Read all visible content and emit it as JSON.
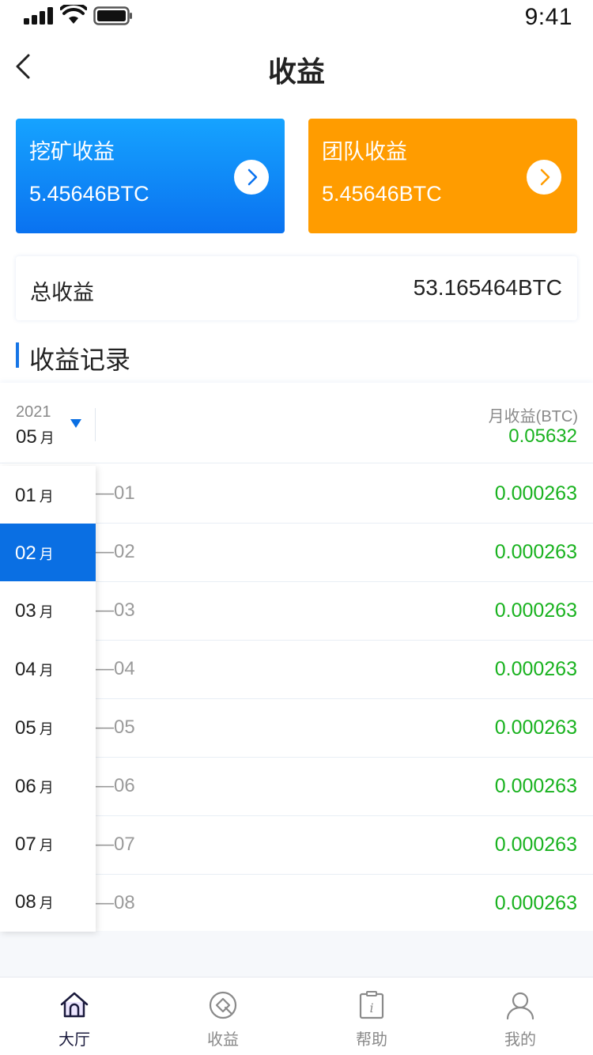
{
  "status_bar": {
    "time": "9:41"
  },
  "header": {
    "title": "收益"
  },
  "cards": {
    "mining": {
      "label": "挖矿收益",
      "value": "5.45646BTC",
      "color": "#0a72f0"
    },
    "team": {
      "label": "团队收益",
      "value": "5.45646BTC",
      "color": "#ff9c00"
    }
  },
  "total": {
    "label": "总收益",
    "value": "53.165464BTC"
  },
  "records": {
    "title": "收益记录",
    "filter": {
      "year": "2021",
      "month": "05",
      "month_unit": "月",
      "income_label": "月收益(BTC)",
      "income_value": "0.05632"
    },
    "rows": [
      {
        "date": "—01",
        "value": "0.000263"
      },
      {
        "date": "—02",
        "value": "0.000263"
      },
      {
        "date": "—03",
        "value": "0.000263"
      },
      {
        "date": "—04",
        "value": "0.000263"
      },
      {
        "date": "—05",
        "value": "0.000263"
      },
      {
        "date": "—06",
        "value": "0.000263"
      },
      {
        "date": "—07",
        "value": "0.000263"
      },
      {
        "date": "—08",
        "value": "0.000263"
      }
    ]
  },
  "month_dropdown": {
    "unit": "月",
    "selected_index": 1,
    "options": [
      "01",
      "02",
      "03",
      "04",
      "05",
      "06",
      "07",
      "08"
    ]
  },
  "tab_bar": {
    "tabs": [
      {
        "label": "大厅",
        "icon": "home-icon",
        "active": true
      },
      {
        "label": "收益",
        "icon": "earnings-icon",
        "active": false
      },
      {
        "label": "帮助",
        "icon": "help-icon",
        "active": false
      },
      {
        "label": "我的",
        "icon": "profile-icon",
        "active": false
      }
    ]
  },
  "colors": {
    "accent": "#0a6fe3",
    "positive": "#19b21f",
    "orange": "#ff9c00"
  }
}
